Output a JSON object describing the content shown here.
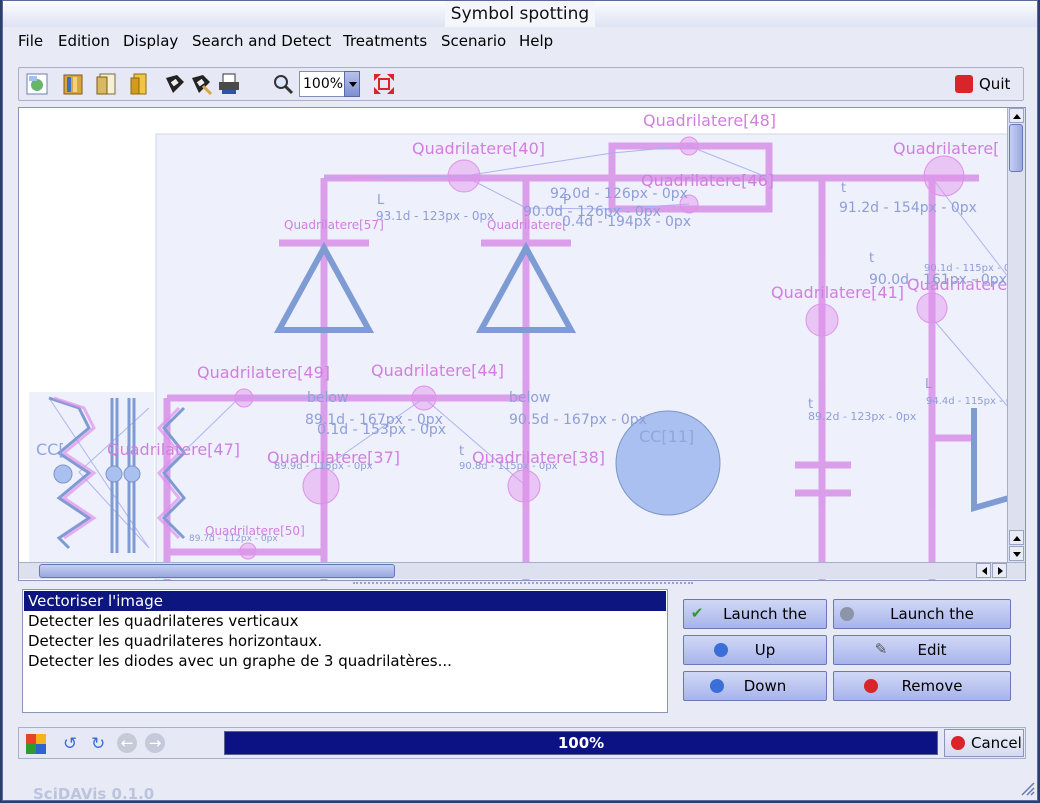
{
  "window": {
    "title": "Symbol spotting"
  },
  "menu": [
    "File",
    "Edition",
    "Display",
    "Search and Detect",
    "Treatments",
    "Scenario",
    "Help"
  ],
  "toolbar": {
    "icons": [
      "import-image-icon",
      "open-book-icon",
      "open-pages-icon",
      "open-folder-icon",
      "save-icon",
      "save-as-icon",
      "print-icon",
      "zoom-icon",
      "fit-window-icon"
    ],
    "zoom_value": "100%",
    "quit_label": "Quit"
  },
  "canvas": {
    "labels": [
      "Quadrilatere[48]",
      "Quadrilatere[40]",
      "Quadrilatere[46]",
      "Quadrilatere[",
      "Quadrilatere[57]",
      "Quadrilatere[",
      "Quadrilatere[41]",
      "Quadrilatere[4",
      "Quadrilatere[49]",
      "Quadrilatere[44]",
      "Quadrilatere[37]",
      "Quadrilatere[38]",
      "Quadrilatere[50]",
      "CC[11]",
      "CC[",
      "Quadrilatere[47]"
    ],
    "measures": [
      "93.1d - 123px - 0px",
      "92.0d - 126px - 0px",
      "90.0d - 126px - 0px",
      "0.4d - 194px - 0px",
      "91.2d - 154px - 0px",
      "90.0d - 161px - 0px",
      "89.1d - 167px - 0px",
      "0.1d - 153px - 0px",
      "90.5d - 167px - 0px",
      "89.9d - 115px - 0px",
      "90.8d - 115px - 0px",
      "89.2d - 123px - 0px",
      "89.7d - 112px - 0px",
      "90.1d - 115px - 0px",
      "94.4d - 115px - 0px"
    ],
    "relations": [
      "L",
      "P",
      "t",
      "below",
      "below",
      "t",
      "t",
      "L",
      "t"
    ]
  },
  "rules": [
    "Vectoriser l'image",
    "Detecter les quadrilateres verticaux",
    "Detecter les quadrilateres horizontaux.",
    "Detecter les diodes avec un graphe de 3 quadrilatères..."
  ],
  "selected_rule": 0,
  "buttons": {
    "launch_rule": "Launch the rule",
    "launch_scenario": "Launch the scenario",
    "up": "Up",
    "edit": "Edit",
    "down": "Down",
    "remove": "Remove"
  },
  "status": {
    "progress_text": "100%",
    "progress_fraction": 1.0,
    "cancel_label": "Cancel"
  },
  "background_app": "SciDAVis 0.1.0",
  "colors": {
    "selection": "#0d1580",
    "progress": "#0c1284",
    "drawing_blue": "#6f8fcf",
    "detection_pink": "#e08ce8"
  }
}
